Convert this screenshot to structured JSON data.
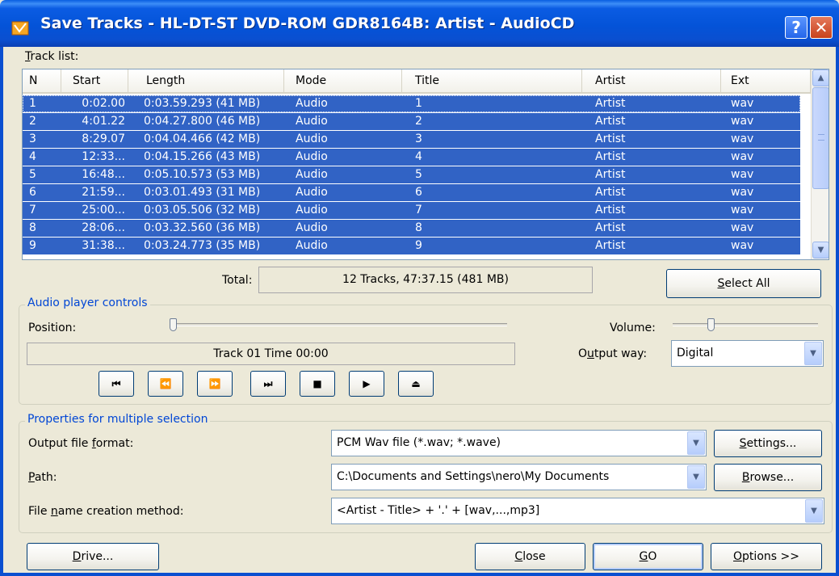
{
  "window": {
    "title": "Save Tracks - HL-DT-ST DVD-ROM GDR8164B:  Artist - AudioCD",
    "help_label": "?",
    "close_label": "✕"
  },
  "tracklist": {
    "label": "Track list:",
    "columns": [
      "N",
      "Start",
      "Length",
      "Mode",
      "Title",
      "Artist",
      "Ext"
    ],
    "rows": [
      {
        "n": "1",
        "start": "0:02.00",
        "length": "0:03.59.293 (41 MB)",
        "mode": "Audio",
        "title": "1",
        "artist": "Artist",
        "ext": "wav"
      },
      {
        "n": "2",
        "start": "4:01.22",
        "length": "0:04.27.800 (46 MB)",
        "mode": "Audio",
        "title": "2",
        "artist": "Artist",
        "ext": "wav"
      },
      {
        "n": "3",
        "start": "8:29.07",
        "length": "0:04.04.466 (42 MB)",
        "mode": "Audio",
        "title": "3",
        "artist": "Artist",
        "ext": "wav"
      },
      {
        "n": "4",
        "start": "12:33...",
        "length": "0:04.15.266 (43 MB)",
        "mode": "Audio",
        "title": "4",
        "artist": "Artist",
        "ext": "wav"
      },
      {
        "n": "5",
        "start": "16:48...",
        "length": "0:05.10.573 (53 MB)",
        "mode": "Audio",
        "title": "5",
        "artist": "Artist",
        "ext": "wav"
      },
      {
        "n": "6",
        "start": "21:59...",
        "length": "0:03.01.493 (31 MB)",
        "mode": "Audio",
        "title": "6",
        "artist": "Artist",
        "ext": "wav"
      },
      {
        "n": "7",
        "start": "25:00...",
        "length": "0:03.05.506 (32 MB)",
        "mode": "Audio",
        "title": "7",
        "artist": "Artist",
        "ext": "wav"
      },
      {
        "n": "8",
        "start": "28:06...",
        "length": "0:03.32.560 (36 MB)",
        "mode": "Audio",
        "title": "8",
        "artist": "Artist",
        "ext": "wav"
      },
      {
        "n": "9",
        "start": "31:38...",
        "length": "0:03.24.773 (35 MB)",
        "mode": "Audio",
        "title": "9",
        "artist": "Artist",
        "ext": "wav"
      }
    ],
    "selected_color": "#3163c5"
  },
  "total": {
    "label": "Total:",
    "value": "12 Tracks,   47:37.15 (481 MB)"
  },
  "select_all_label": "Select All",
  "audio": {
    "group_title": "Audio player controls",
    "position_label": "Position:",
    "volume_label": "Volume:",
    "status": "Track 01 Time 00:00",
    "output_way_label": "Output way:",
    "output_way_value": "Digital",
    "buttons": [
      "prev-track-icon",
      "rewind-icon",
      "fast-forward-icon",
      "next-track-icon",
      "stop-icon",
      "play-icon",
      "eject-icon"
    ]
  },
  "props": {
    "group_title": "Properties for multiple selection",
    "format_label": "Output file format:",
    "format_value": "PCM Wav file (*.wav; *.wave)",
    "path_label": "Path:",
    "path_value": "C:\\Documents and Settings\\nero\\My Documents",
    "method_label": "File name creation method:",
    "method_value": "<Artist - Title> + '.' + [wav,...,mp3]",
    "settings_label": "Settings...",
    "browse_label": "Browse..."
  },
  "footer": {
    "drive_label": "Drive...",
    "close_label": "Close",
    "go_label": "GO",
    "options_label": "Options >>"
  }
}
